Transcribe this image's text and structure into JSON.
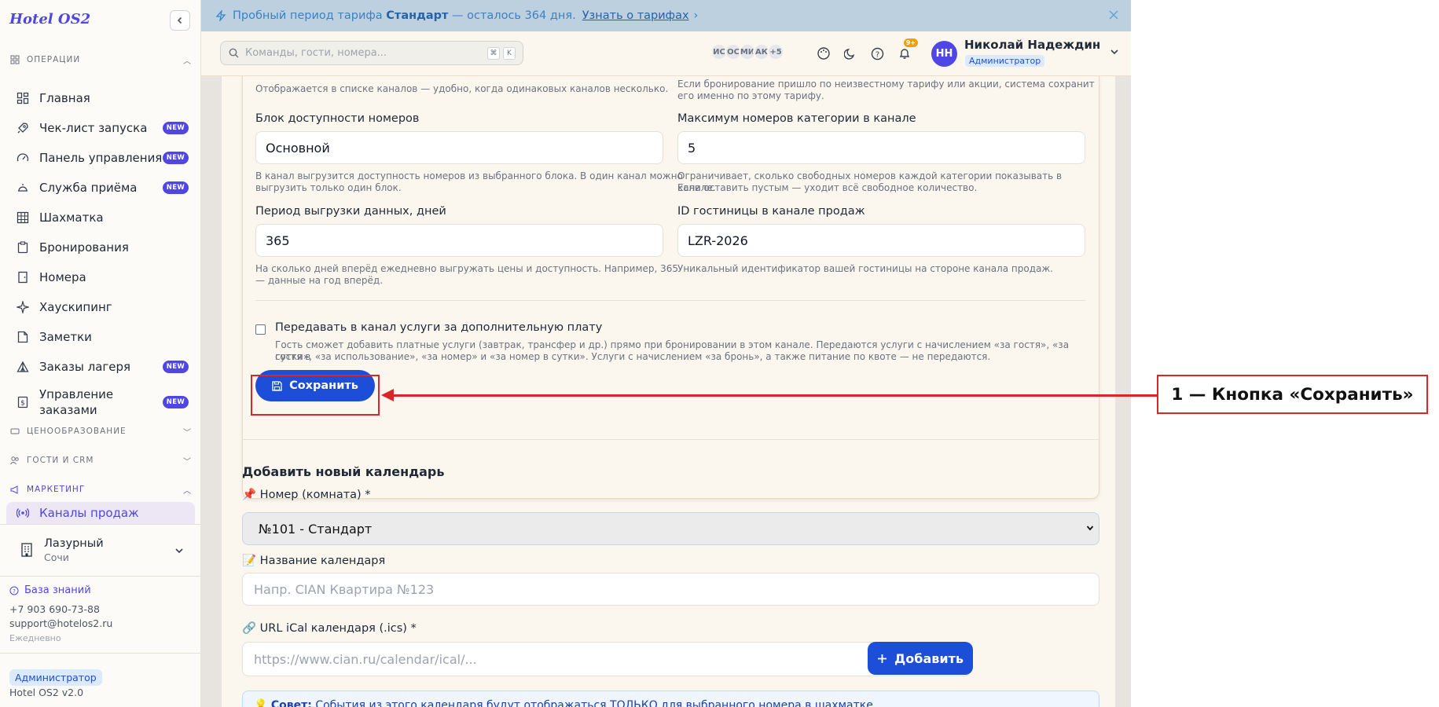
{
  "app": {
    "logo": "Hotel OS2"
  },
  "sidebar": {
    "sections": {
      "operations": "ОПЕРАЦИИ",
      "pricing": "ЦЕНООБРАЗОВАНИЕ",
      "guests": "ГОСТИ И CRM",
      "marketing": "МАРКЕТИНГ"
    },
    "items": [
      {
        "label": "Главная",
        "icon": "dashboard-icon",
        "badge": ""
      },
      {
        "label": "Чек-лист запуска",
        "icon": "rocket-icon",
        "badge": "NEW"
      },
      {
        "label": "Панель управления",
        "icon": "gauge-icon",
        "badge": "NEW"
      },
      {
        "label": "Служба приёма",
        "icon": "bell-service-icon",
        "badge": "NEW"
      },
      {
        "label": "Шахматка",
        "icon": "grid-icon",
        "badge": ""
      },
      {
        "label": "Бронирования",
        "icon": "clipboard-icon",
        "badge": ""
      },
      {
        "label": "Номера",
        "icon": "door-icon",
        "badge": ""
      },
      {
        "label": "Хаускипинг",
        "icon": "sparkles-icon",
        "badge": ""
      },
      {
        "label": "Заметки",
        "icon": "note-icon",
        "badge": ""
      },
      {
        "label": "Заказы лагеря",
        "icon": "tent-icon",
        "badge": "NEW"
      },
      {
        "label": "Управление заказами",
        "icon": "receipt-icon",
        "badge": "NEW"
      }
    ],
    "active_item": {
      "label": "Каналы продаж",
      "icon": "radio-icon"
    },
    "hotel": {
      "name": "Лазурный",
      "city": "Сочи"
    },
    "knowledge_base": "База знаний",
    "phone": "+7 903 690-73-88",
    "email": "support@hotelos2.ru",
    "schedule": "Ежедневно",
    "role": "Администратор",
    "version": "Hotel OS2 v2.0"
  },
  "banner": {
    "prefix": "Пробный период тарифа",
    "plan": "Стандарт",
    "suffix": "— осталось 364 дня.",
    "link": "Узнать о тарифах"
  },
  "topbar": {
    "search_placeholder": "Команды, гости, номера...",
    "kbd1": "⌘",
    "kbd2": "K",
    "avatars": [
      "ИС",
      "ОС",
      "МИ",
      "АК"
    ],
    "avatars_more": "+5",
    "notif_count": "9+",
    "user_initials": "НН",
    "user_name": "Николай Надеждин",
    "user_role": "Администратор"
  },
  "form": {
    "hint_channel_name": "Отображается в списке каналов — удобно, когда одинаковых каналов несколько.",
    "hint_tariff_line1": "Если бронирование пришло по неизвестному тарифу или акции, система сохранит",
    "hint_tariff_line2": "его именно по этому тарифу.",
    "block_label": "Блок доступности номеров",
    "block_value": "Основной",
    "block_hint_line1": "В канал выгрузится доступность номеров из выбранного блока. В один канал можно",
    "block_hint_line2": "выгрузить только один блок.",
    "max_label": "Максимум номеров категории в канале",
    "max_value": "5",
    "max_hint_line1": "Ограничивает, сколько свободных номеров каждой категории показывать в канале.",
    "max_hint_line2": "Если оставить пустым — уходит всё свободное количество.",
    "period_label": "Период выгрузки данных, дней",
    "period_value": "365",
    "period_hint_line1": "На сколько дней вперёд ежедневно выгружать цены и доступность. Например, 365",
    "period_hint_line2": "— данные на год вперёд.",
    "hotelid_label": "ID гостиницы в канале продаж",
    "hotelid_value": "LZR-2026",
    "hotelid_hint": "Уникальный идентификатор вашей гостиницы на стороне канала продаж.",
    "services_label": "Передавать в канал услуги за дополнительную плату",
    "services_hint_line1": "Гость сможет добавить платные услуги (завтрак, трансфер и др.) прямо при бронировании в этом канале. Передаются услуги с начислением «за гостя», «за гостя в",
    "services_hint_line2": "сутки», «за использование», «за номер» и «за номер в сутки». Услуги с начислением «за бронь», а также питание по квоте — не передаются.",
    "save_label": "Сохранить"
  },
  "annotation": {
    "label": "1 — Кнопка «Сохранить»"
  },
  "calendar": {
    "title": "Добавить новый календарь",
    "room_label": "📌 Номер (комната) *",
    "room_value": "№101 - Стандарт",
    "name_label": "📝 Название календаря",
    "name_placeholder": "Напр. CIAN Квартира №123",
    "url_label": "🔗 URL iCal календаря (.ics) *",
    "url_placeholder": "https://www.cian.ru/calendar/ical/...",
    "add_label": "Добавить",
    "tip_bold": "Совет:",
    "tip_text": "События из этого календаря будут отображаться ТОЛЬКО для выбранного номера в шахматке"
  },
  "colors": {
    "accent": "#4f46e5",
    "primary_button": "#1d4ed8",
    "annotation": "#dc2626"
  }
}
